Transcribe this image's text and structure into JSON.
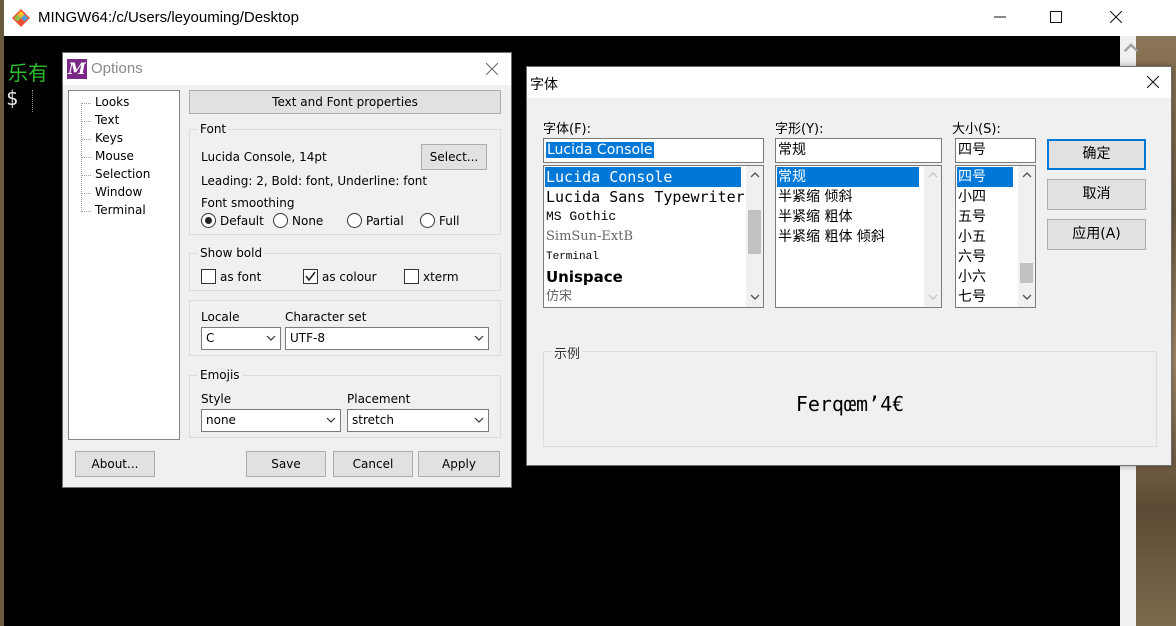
{
  "mintty": {
    "title": "MINGW64:/c/Users/leyouming/Desktop",
    "terminal_line1": "乐有",
    "terminal_prompt": "$"
  },
  "options": {
    "title": "Options",
    "tree": [
      "Looks",
      "Text",
      "Keys",
      "Mouse",
      "Selection",
      "Window",
      "Terminal"
    ],
    "section_header": "Text and Font properties",
    "font_group": "Font",
    "font_value": "Lucida Console, 14pt",
    "select_button": "Select...",
    "font_details": "Leading: 2, Bold: font, Underline: font",
    "font_smoothing_label": "Font smoothing",
    "smoothing_options": [
      {
        "label": "Default",
        "selected": true
      },
      {
        "label": "None",
        "selected": false
      },
      {
        "label": "Partial",
        "selected": false
      },
      {
        "label": "Full",
        "selected": false
      }
    ],
    "show_bold_group": "Show bold",
    "show_bold_options": [
      {
        "label": "as font",
        "checked": false
      },
      {
        "label": "as colour",
        "checked": true
      },
      {
        "label": "xterm",
        "checked": false
      }
    ],
    "locale_label": "Locale",
    "locale_value": "C",
    "charset_label": "Character set",
    "charset_value": "UTF-8",
    "emojis_group": "Emojis",
    "style_label": "Style",
    "style_value": "none",
    "placement_label": "Placement",
    "placement_value": "stretch",
    "about_button": "About...",
    "save_button": "Save",
    "cancel_button": "Cancel",
    "apply_button": "Apply"
  },
  "font_dialog": {
    "title": "字体",
    "font_label": "字体(F):",
    "font_value": "Lucida Console",
    "fonts": [
      "Lucida Console",
      "Lucida Sans Typewriter",
      "MS Gothic",
      "SimSun-ExtB",
      "Terminal",
      "Unispace",
      "仿宋"
    ],
    "style_label": "字形(Y):",
    "style_value": "常规",
    "styles": [
      "常规",
      "半紧缩 倾斜",
      "半紧缩 粗体",
      "半紧缩 粗体 倾斜"
    ],
    "size_label": "大小(S):",
    "size_value": "四号",
    "sizes": [
      "四号",
      "小四",
      "五号",
      "小五",
      "六号",
      "小六",
      "七号"
    ],
    "ok_button": "确定",
    "cancel_button": "取消",
    "apply_button": "应用(A)",
    "sample_label": "示例",
    "sample_text": "Ferqœm’4€"
  },
  "colors": {
    "selection_blue": "#0078d7",
    "terminal_green": "#2bbf2b",
    "dialog_bg": "#f0f0f0"
  }
}
